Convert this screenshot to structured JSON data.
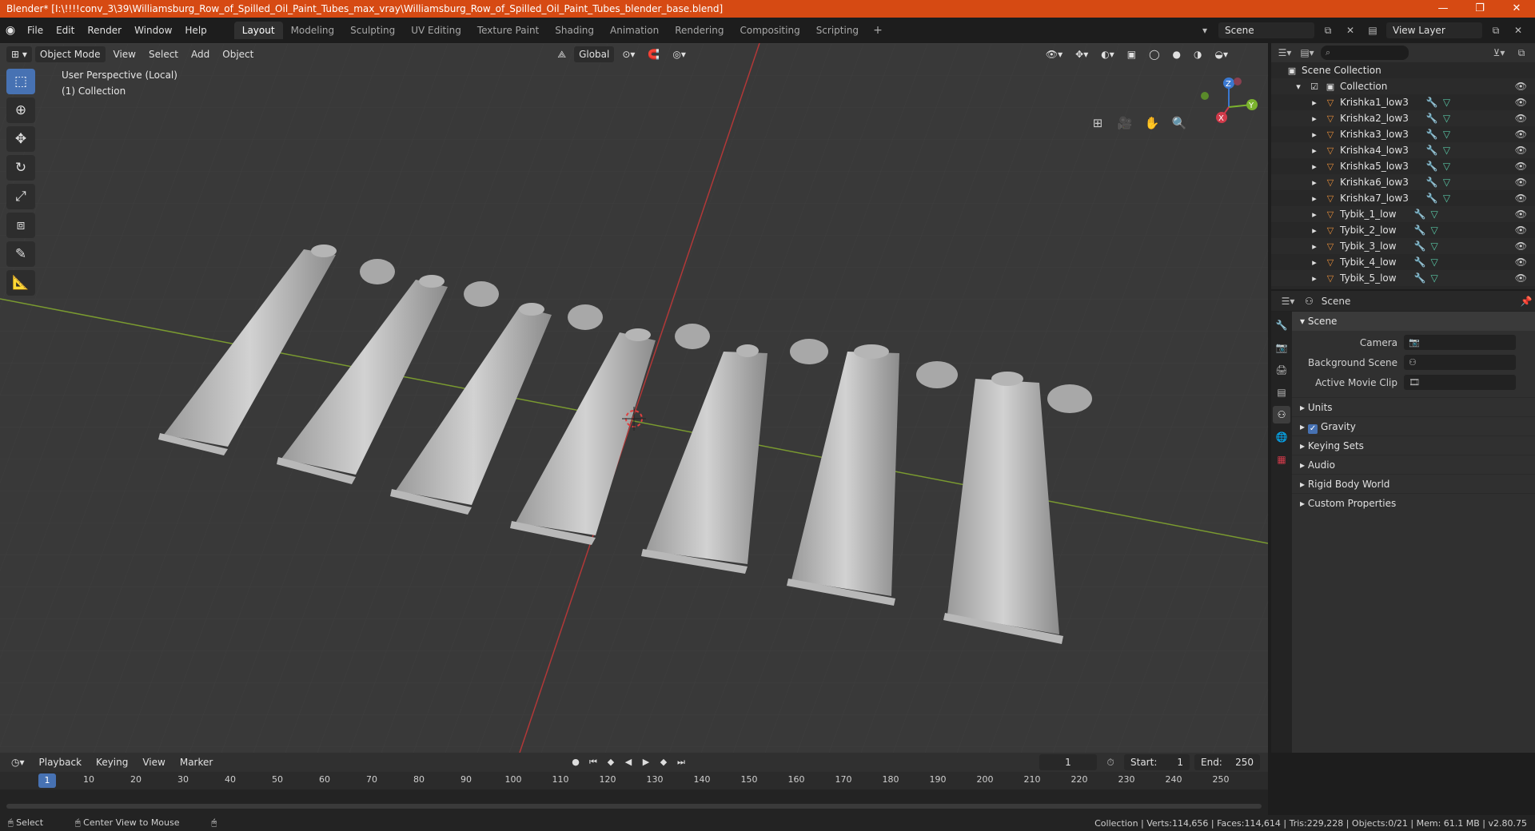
{
  "titlebar": {
    "title": "Blender* [I:\\!!!!conv_3\\39\\Williamsburg_Row_of_Spilled_Oil_Paint_Tubes_max_vray\\Williamsburg_Row_of_Spilled_Oil_Paint_Tubes_blender_base.blend]",
    "minimize": "—",
    "maximize": "❐",
    "close": "✕"
  },
  "menu": [
    "File",
    "Edit",
    "Render",
    "Window",
    "Help"
  ],
  "workspaces": [
    "Layout",
    "Modeling",
    "Sculpting",
    "UV Editing",
    "Texture Paint",
    "Shading",
    "Animation",
    "Rendering",
    "Compositing",
    "Scripting"
  ],
  "active_workspace": "Layout",
  "scene_field": "Scene",
  "view_layer_field": "View Layer",
  "viewport": {
    "mode": "Object Mode",
    "menus": [
      "View",
      "Select",
      "Add",
      "Object"
    ],
    "transform_orientation": "Global",
    "info_line1": "User Perspective (Local)",
    "info_line2": "(1) Collection",
    "gizmo_axes": {
      "x": "X",
      "y": "Y",
      "z": "Z"
    }
  },
  "outliner": {
    "root": "Scene Collection",
    "collection": "Collection",
    "items": [
      "Krishka1_low3",
      "Krishka2_low3",
      "Krishka3_low3",
      "Krishka4_low3",
      "Krishka5_low3",
      "Krishka6_low3",
      "Krishka7_low3",
      "Tybik_1_low",
      "Tybik_2_low",
      "Tybik_3_low",
      "Tybik_4_low",
      "Tybik_5_low"
    ]
  },
  "properties": {
    "header": "Scene",
    "panel": "Scene",
    "camera_label": "Camera",
    "background_scene_label": "Background Scene",
    "active_movie_clip_label": "Active Movie Clip",
    "subpanels": [
      "Units",
      "Gravity",
      "Keying Sets",
      "Audio",
      "Rigid Body World",
      "Custom Properties"
    ]
  },
  "timeline": {
    "menus": [
      "Playback",
      "Keying",
      "View",
      "Marker"
    ],
    "current_frame": "1",
    "start_label": "Start:",
    "start": "1",
    "end_label": "End:",
    "end": "250",
    "ticks": [
      "10",
      "20",
      "30",
      "40",
      "50",
      "60",
      "70",
      "80",
      "90",
      "100",
      "110",
      "120",
      "130",
      "140",
      "150",
      "160",
      "170",
      "180",
      "190",
      "200",
      "210",
      "220",
      "230",
      "240",
      "250"
    ]
  },
  "statusbar": {
    "left": "Select",
    "middle": "Center View to Mouse",
    "stats": "Collection | Verts:114,656 | Faces:114,614 | Tris:229,228 | Objects:0/21 | Mem: 61.1 MB | v2.80.75"
  }
}
